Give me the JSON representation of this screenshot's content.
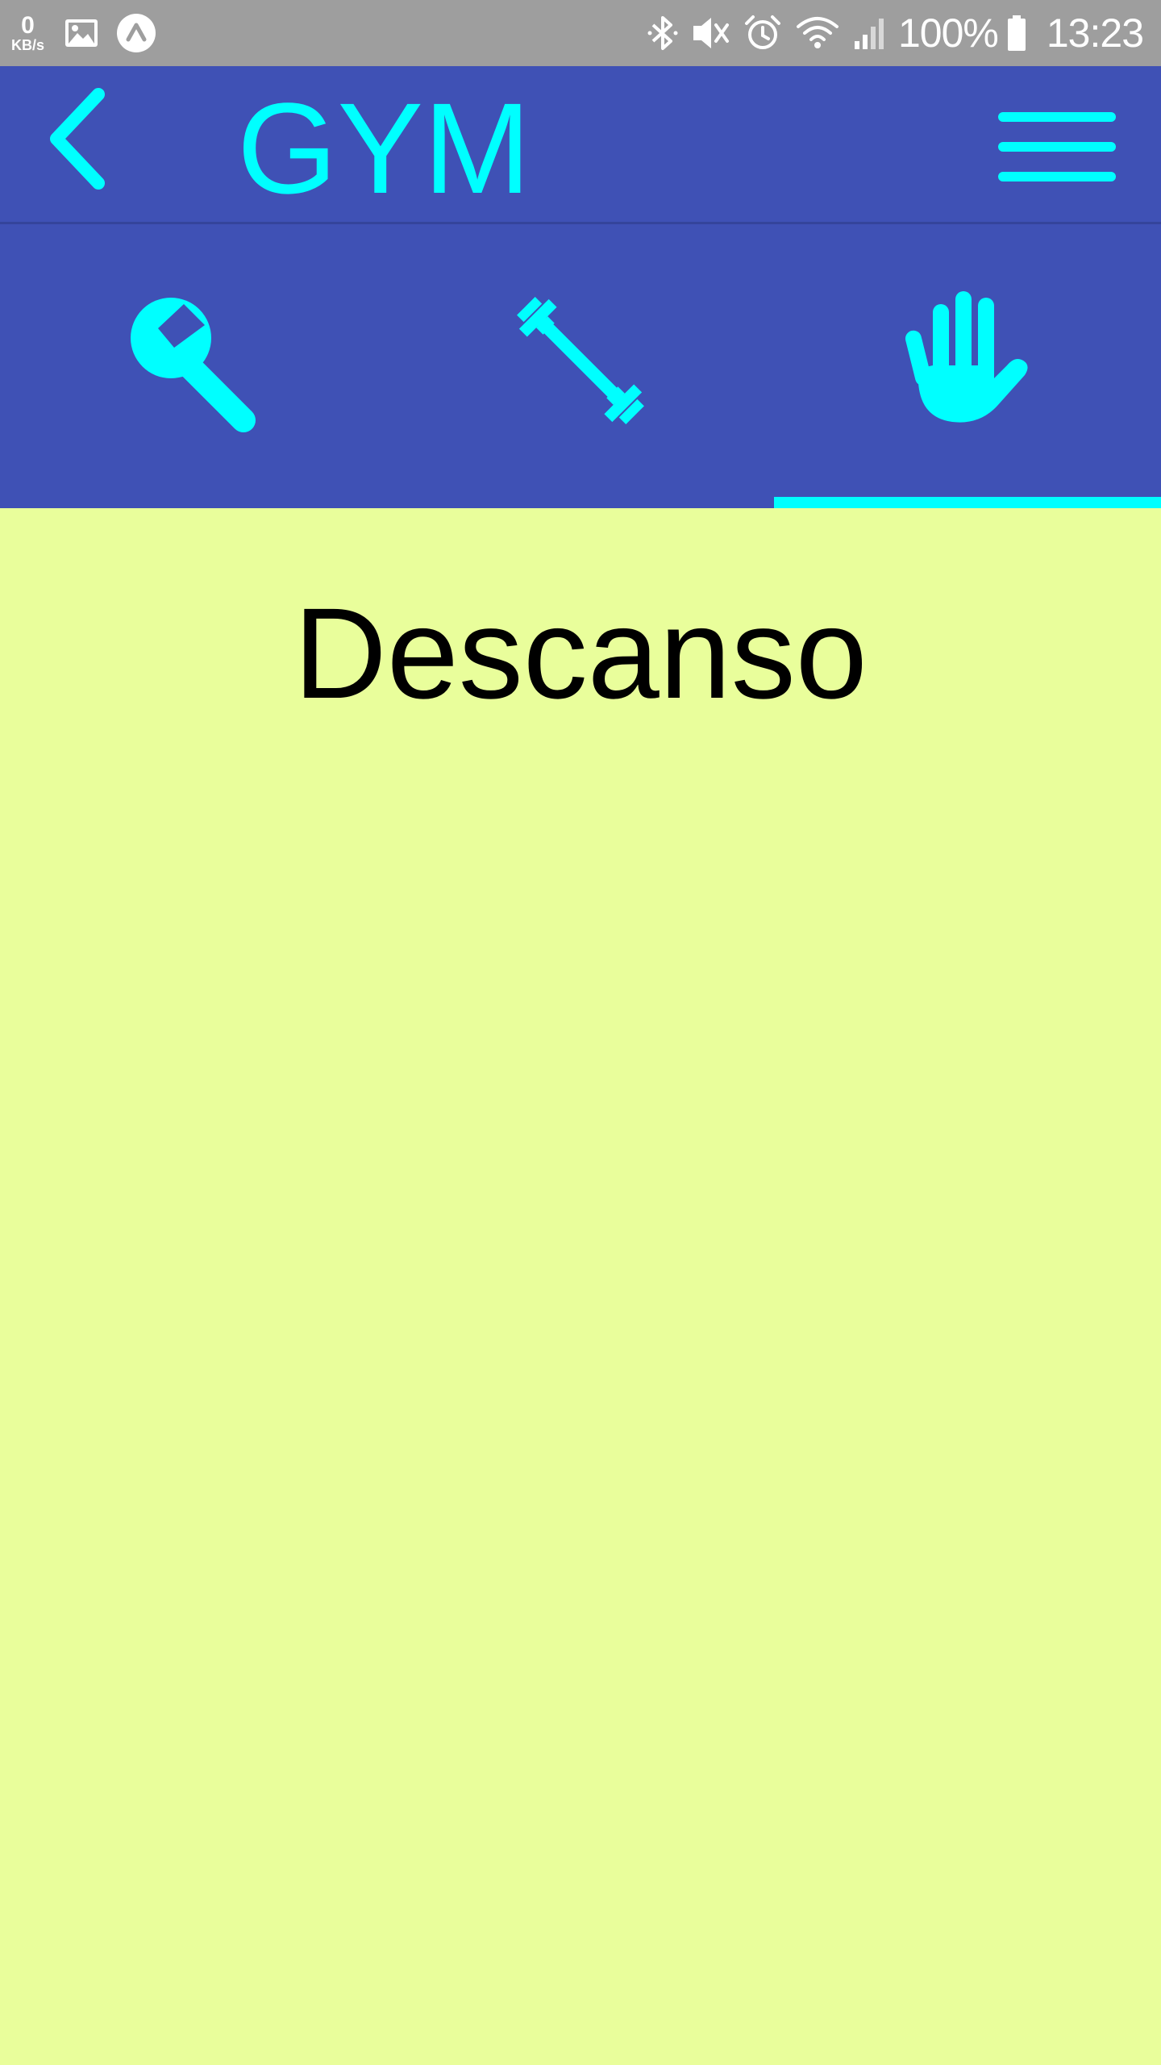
{
  "status_bar": {
    "net_speed_value": "0",
    "net_speed_unit": "KB/s",
    "battery_percent": "100%",
    "time": "13:23",
    "icons": [
      "image-icon",
      "app-notification-icon",
      "bluetooth-icon",
      "mute-icon",
      "alarm-icon",
      "wifi-icon",
      "signal-icon",
      "battery-icon"
    ]
  },
  "app_bar": {
    "title": "GYM",
    "back_icon": "chevron-left-icon",
    "menu_icon": "hamburger-menu-icon"
  },
  "tabs": [
    {
      "icon": "wrench-icon",
      "selected": false
    },
    {
      "icon": "dumbbell-icon",
      "selected": false
    },
    {
      "icon": "hand-icon",
      "selected": true
    }
  ],
  "content": {
    "title": "Descanso"
  },
  "colors": {
    "status_bar": "#9e9e9e",
    "primary": "#3f51b5",
    "accent": "#00ffff",
    "background": "#e9fe9b",
    "text": "#000000"
  }
}
